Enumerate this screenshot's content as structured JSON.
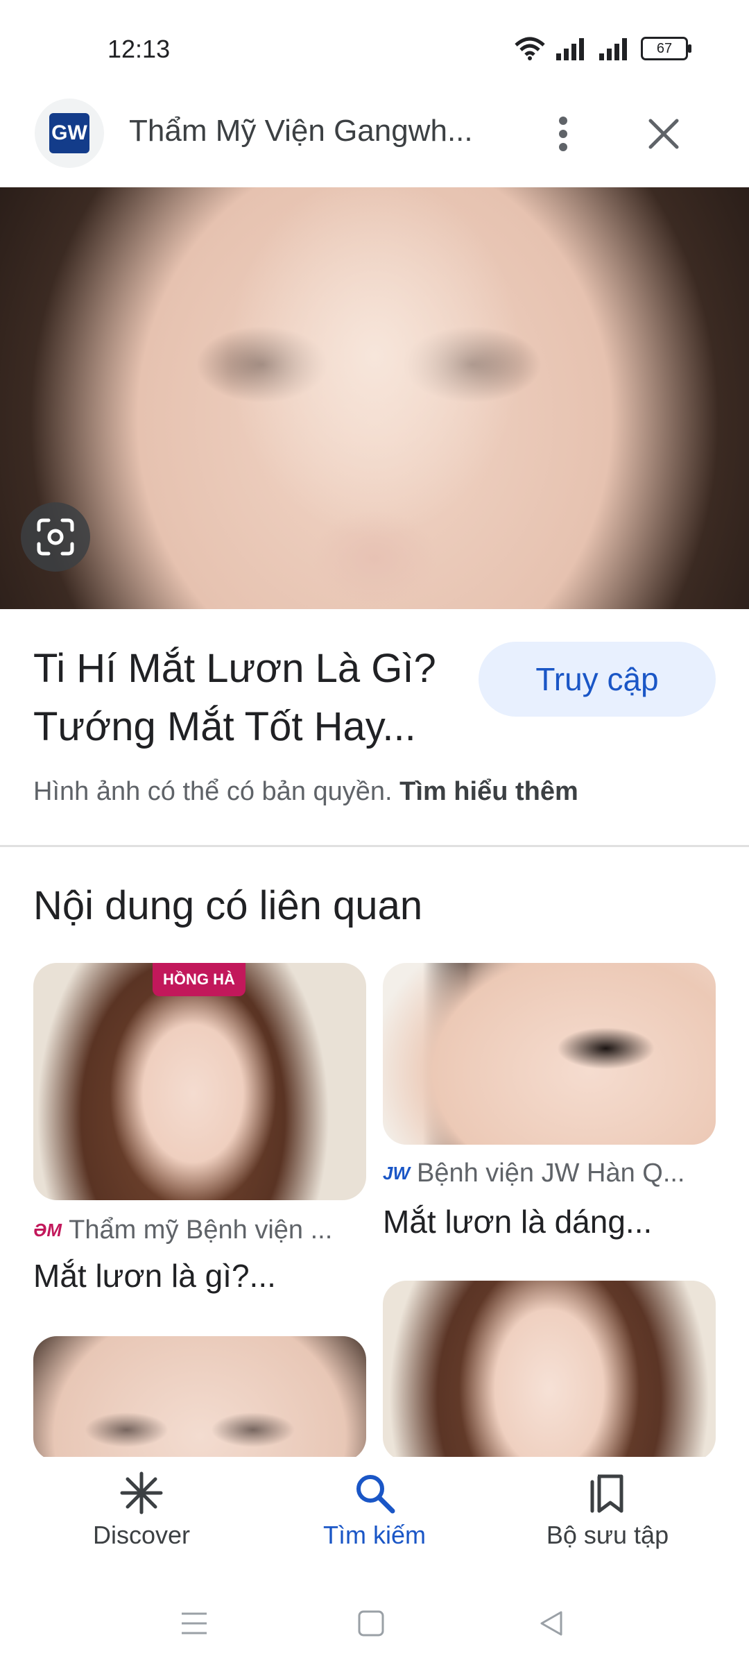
{
  "status_bar": {
    "time": "12:13",
    "battery": "67"
  },
  "header": {
    "site_logo_text": "GW",
    "title": "Thẩm Mỹ Viện Gangwh..."
  },
  "image": {
    "title": "Ti Hí Mắt Lươn Là Gì? Tướng Mắt Tốt Hay...",
    "visit_button": "Truy cập",
    "copyright_text": "Hình ảnh có thể có bản quyền.",
    "learn_more": "Tìm hiểu thêm"
  },
  "related": {
    "heading": "Nội dung có liên quan",
    "cards": [
      {
        "brand_tag": "HỒNG HÀ",
        "source_icon": "ƏM",
        "source": "Thẩm mỹ Bệnh viện ...",
        "title": "Mắt lươn là gì?..."
      },
      {
        "source_icon": "JW",
        "source": "Bệnh viện JW Hàn Q...",
        "title": "Mắt lươn là dáng..."
      },
      {},
      {}
    ]
  },
  "bottom_nav": {
    "items": [
      {
        "label": "Discover",
        "icon": "discover-icon"
      },
      {
        "label": "Tìm kiếm",
        "icon": "search-icon"
      },
      {
        "label": "Bộ sưu tập",
        "icon": "collections-icon"
      }
    ],
    "active": "Tìm kiếm"
  },
  "colors": {
    "accent": "#1a56c6",
    "visit_bg": "#e8f0fe",
    "text": "#202124",
    "secondary": "#5f6368"
  }
}
